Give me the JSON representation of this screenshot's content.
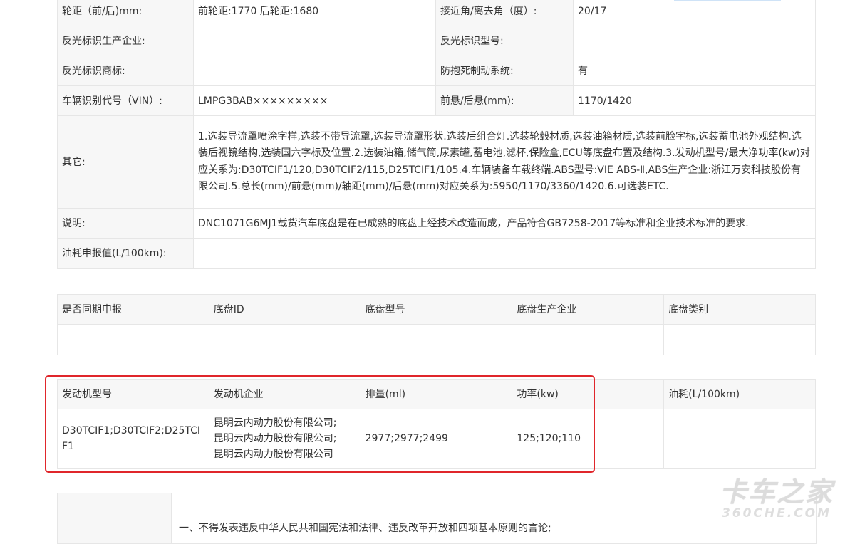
{
  "spec_rows": [
    {
      "label1": "轮距（前/后)mm:",
      "value1": "前轮距:1770 后轮距:1680",
      "label2": "接近角/离去角（度）:",
      "value2": "20/17"
    },
    {
      "label1": "反光标识生产企业:",
      "value1": "",
      "label2": "反光标识型号:",
      "value2": ""
    },
    {
      "label1": "反光标识商标:",
      "value1": "",
      "label2": "防抱死制动系统:",
      "value2": "有"
    },
    {
      "label1": "车辆识别代号（VIN）:",
      "value1": "LMPG3BAB×××××××××",
      "label2": "前悬/后悬(mm):",
      "value2": "1170/1420"
    }
  ],
  "other": {
    "label": "其它:",
    "value": "1.选装导流罩喷涂字样,选装不带导流罩,选装导流罩形状.选装后组合灯.选装轮毂材质,选装油箱材质,选装前脸字标,选装蓄电池外观结构.选装后视镜结构,选装国六字标及位置.2.选装油箱,储气筒,尿素罐,蓄电池,滤杯,保险盒,ECU等底盘布置及结构.3.发动机型号/最大净功率(kw)对应关系为:D30TCIF1/120,D30TCIF2/115,D25TCIF1/105.4.车辆装备车载终端.ABS型号:VIE ABS-Ⅱ,ABS生产企业:浙江万安科技股份有限公司.5.总长(mm)/前悬(mm)/轴距(mm)/后悬(mm)对应关系为:5950/1170/3360/1420.6.可选装ETC."
  },
  "note": {
    "label": "说明:",
    "value": "DNC1071G6MJ1载货汽车底盘是在已成熟的底盘上经技术改造而成，产品符合GB7258-2017等标准和企业技术标准的要求."
  },
  "fuel": {
    "label": "油耗申报值(L/100km):",
    "value": ""
  },
  "chassis": {
    "headers": [
      "是否同期申报",
      "底盘ID",
      "底盘型号",
      "底盘生产企业",
      "底盘类别"
    ],
    "row": [
      "",
      "",
      "",
      "",
      ""
    ]
  },
  "engine": {
    "headers": [
      "发动机型号",
      "发动机企业",
      "排量(ml)",
      "功率(kw)",
      "油耗(L/100km)"
    ],
    "row": {
      "model": "D30TCIF1;D30TCIF2;D25TCIF1",
      "companies": [
        "昆明云内动力股份有限公司;",
        "昆明云内动力股份有限公司;",
        "昆明云内动力股份有限公司"
      ],
      "displacement": "2977;2977;2499",
      "power": "125;120;110",
      "fuel": ""
    }
  },
  "bottom_notice": "一、不得发表违反中华人民共和国宪法和法律、违反改革开放和四项基本原则的言论;",
  "watermark": {
    "cn": "卡车之家",
    "en": "360CHE.COM"
  },
  "colors": {
    "highlight": "#e0262b",
    "label_bg": "#f7f7f7",
    "border": "#e6e6e6"
  }
}
